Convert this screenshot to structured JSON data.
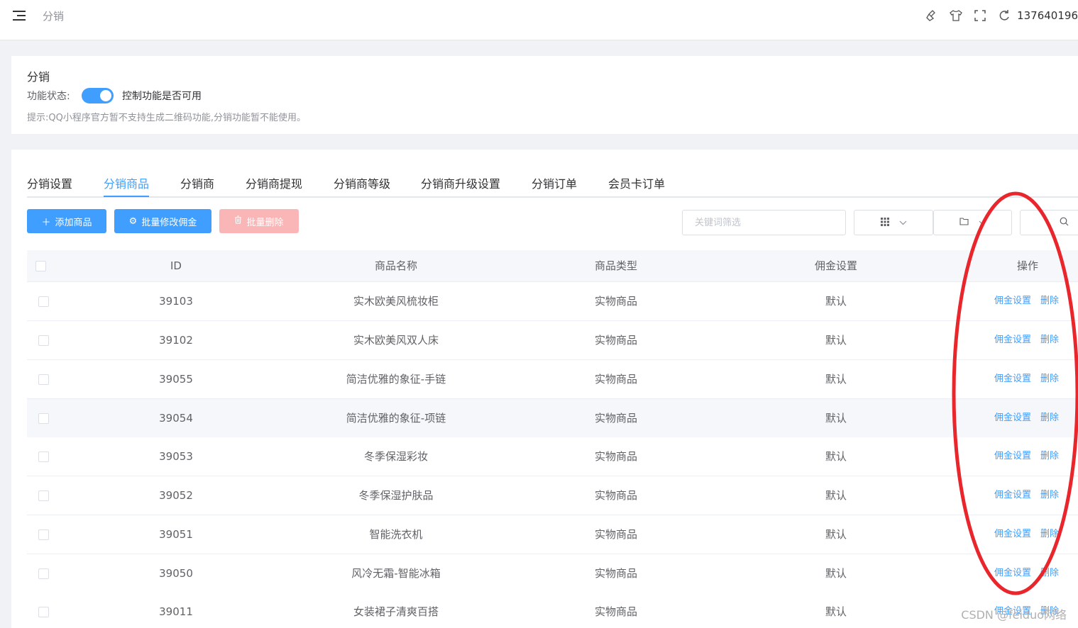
{
  "header": {
    "breadcrumb": "分销",
    "icons": [
      "broom-icon",
      "shirt-icon",
      "fullscreen-icon",
      "refresh-icon"
    ],
    "user": "137640196"
  },
  "status_card": {
    "title": "分销",
    "status_label": "功能状态:",
    "switch_on": true,
    "switch_text": "控制功能是否可用",
    "tip": "提示:QQ小程序官方暂不支持生成二维码功能,分销功能暂不能使用。"
  },
  "tabs": [
    {
      "label": "分销设置",
      "active": false
    },
    {
      "label": "分销商品",
      "active": true
    },
    {
      "label": "分销商",
      "active": false
    },
    {
      "label": "分销商提现",
      "active": false
    },
    {
      "label": "分销商等级",
      "active": false
    },
    {
      "label": "分销商升级设置",
      "active": false
    },
    {
      "label": "分销订单",
      "active": false
    },
    {
      "label": "会员卡订单",
      "active": false
    }
  ],
  "toolbar": {
    "add_label": "添加商品",
    "commission_label": "批量修改佣金",
    "delete_label": "批量删除",
    "search_placeholder": "关键词筛选"
  },
  "table": {
    "columns": [
      "ID",
      "商品名称",
      "商品类型",
      "佣金设置",
      "操作"
    ],
    "rows": [
      {
        "id": "39103",
        "name": "实木欧美风梳妆柜",
        "type": "实物商品",
        "commission": "默认"
      },
      {
        "id": "39102",
        "name": "实木欧美风双人床",
        "type": "实物商品",
        "commission": "默认"
      },
      {
        "id": "39055",
        "name": "简洁优雅的象征-手链",
        "type": "实物商品",
        "commission": "默认"
      },
      {
        "id": "39054",
        "name": "简洁优雅的象征-项链",
        "type": "实物商品",
        "commission": "默认"
      },
      {
        "id": "39053",
        "name": "冬季保湿彩妆",
        "type": "实物商品",
        "commission": "默认"
      },
      {
        "id": "39052",
        "name": "冬季保湿护肤品",
        "type": "实物商品",
        "commission": "默认"
      },
      {
        "id": "39051",
        "name": "智能洗衣机",
        "type": "实物商品",
        "commission": "默认"
      },
      {
        "id": "39050",
        "name": "风冷无霜-智能冰箱",
        "type": "实物商品",
        "commission": "默认"
      },
      {
        "id": "39011",
        "name": "女装裙子清爽百搭",
        "type": "实物商品",
        "commission": "默认"
      }
    ],
    "op_commission": "佣金设置",
    "op_delete": "删除"
  },
  "watermark": "CSDN @feiduo网络",
  "colors": {
    "primary": "#409eff",
    "danger_disabled": "#fab6b6",
    "annotation": "#e8262b"
  }
}
